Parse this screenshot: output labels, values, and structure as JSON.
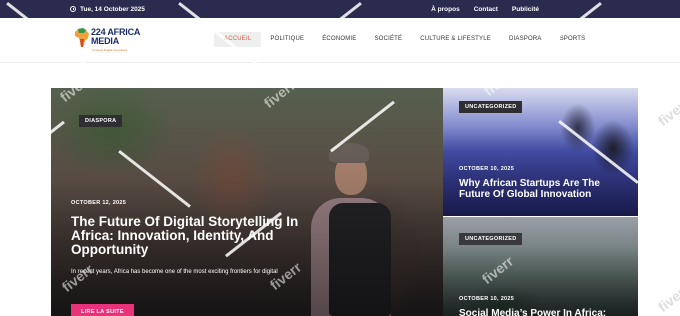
{
  "topbar": {
    "date": "Tue, 14 October 2025",
    "links": [
      "À propos",
      "Contact",
      "Publicité"
    ]
  },
  "logo": {
    "name": "224 AFRICA MEDIA",
    "line1": "224 AFRICA",
    "line2": "MEDIA",
    "tagline": "Connect Digital Innovators",
    "colors": {
      "brand": "#1b2c6e",
      "accent": "#e0732a"
    }
  },
  "nav": {
    "items": [
      "ACCUEIL",
      "POLITIQUE",
      "ÉCONOMIE",
      "SOCIÉTÉ",
      "CULTURE & LIFESTYLE",
      "DIASPORA",
      "SPORTS"
    ],
    "active": "ACCUEIL",
    "active_color": "#e2583e"
  },
  "hero": {
    "category": "DIASPORA",
    "date": "OCTOBER 12, 2025",
    "title": "The Future Of Digital Storytelling In Africa: Innovation, Identity, And Opportunity",
    "excerpt": "In recent years, Africa has become one of the most exciting frontiers for digital",
    "button": "LIRE LA SUITE",
    "button_color": "#e8337a"
  },
  "side_posts": [
    {
      "category": "UNCATEGORIZED",
      "date": "OCTOBER 10, 2025",
      "title": "Why African Startups Are The Future Of Global Innovation"
    },
    {
      "category": "UNCATEGORIZED",
      "date": "OCTOBER 10, 2025",
      "title": "Social Media’s Power In Africa:"
    }
  ],
  "watermark": "fiverr"
}
